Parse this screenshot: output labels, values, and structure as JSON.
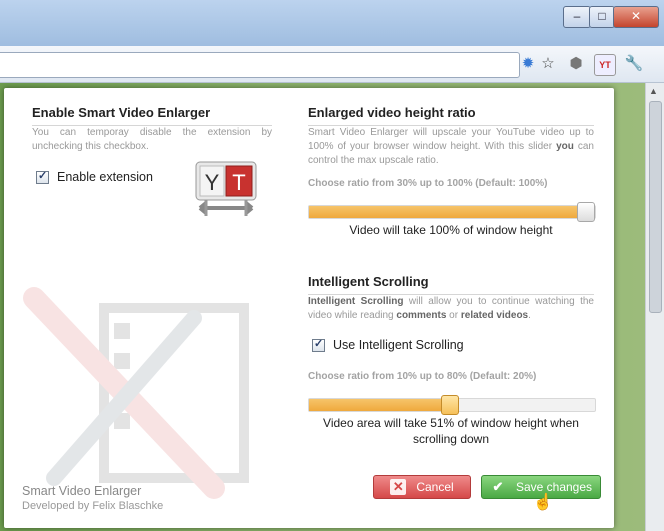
{
  "window": {
    "controls": [
      "–",
      "□",
      "✕"
    ]
  },
  "toolbar": {
    "icons": [
      "puzzle-extension-icon",
      "star-icon",
      "cube-icon",
      "yt-extension-icon",
      "wrench-icon"
    ]
  },
  "popup": {
    "left": {
      "title": "Enable Smart Video Enlarger",
      "description": "You can temporay disable the extension by unchecking this checkbox.",
      "checkbox_label": "Enable extension",
      "checked": true,
      "logo_letters": [
        "Y",
        "T"
      ]
    },
    "height_ratio": {
      "title": "Enlarged video height ratio",
      "description_parts": [
        "Smart Video Enlarger will upscale your YouTube video up to 100% of your browser window height. With this slider ",
        "you",
        " can control the max upscale ratio."
      ],
      "hint": "Choose ratio from 30% up to 100% (Default: 100%)",
      "value_percent": 100,
      "caption": "Video will take 100% of window height"
    },
    "scrolling": {
      "title": "Intelligent Scrolling",
      "description_parts": [
        "Intelligent Scrolling",
        " will allow you to continue watching the video while reading ",
        "comments",
        " or ",
        "related videos",
        "."
      ],
      "checkbox_label": "Use Intelligent Scrolling",
      "checked": true,
      "hint": "Choose ratio from 10% up to 80% (Default: 20%)",
      "value_percent": 51,
      "caption_line1": "Video area will take 51% of window height when",
      "caption_line2": "scrolling down"
    },
    "footer": {
      "title": "Smart Video Enlarger",
      "subtitle": "Developed by Felix Blaschke"
    },
    "buttons": {
      "cancel": "Cancel",
      "save": "Save changes"
    }
  },
  "colors": {
    "slider_fill": "#efa93d",
    "cancel": "#d54848",
    "save": "#4aa944"
  }
}
